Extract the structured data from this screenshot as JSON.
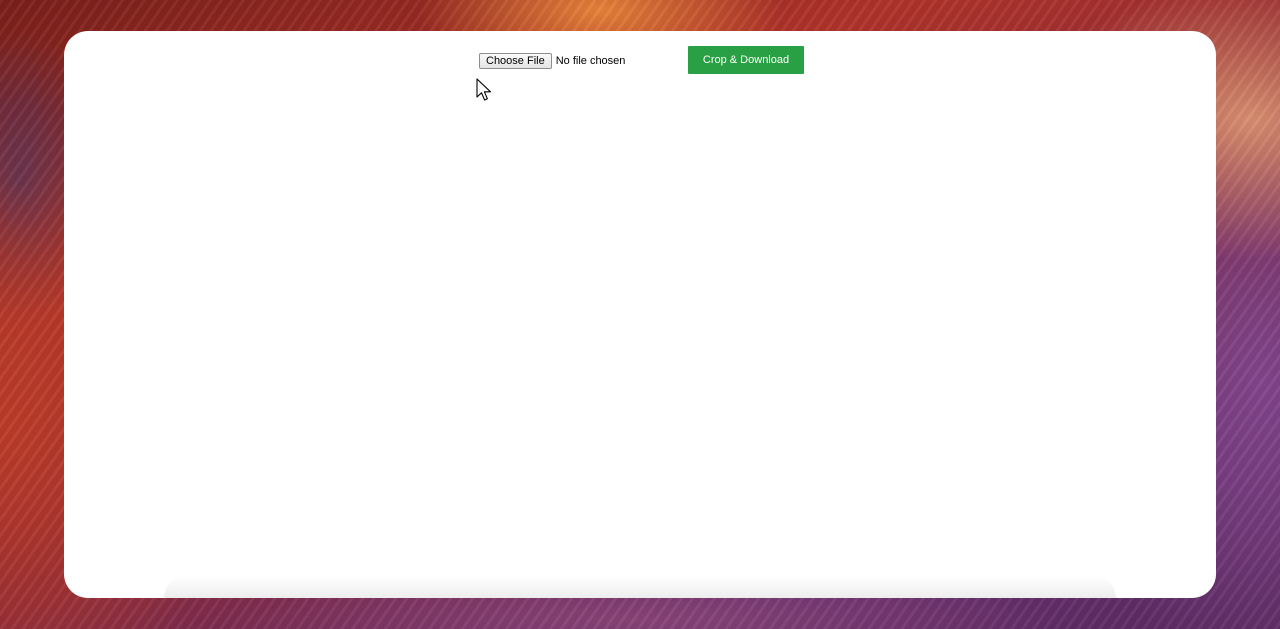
{
  "toolbar": {
    "choose_file_label": "Choose File",
    "file_status": "No file chosen",
    "crop_download_label": "Crop & Download"
  },
  "colors": {
    "accent_button": "#28a043",
    "window_background": "#ffffff"
  },
  "icons": {
    "pointer": "arrow-cursor-icon"
  }
}
